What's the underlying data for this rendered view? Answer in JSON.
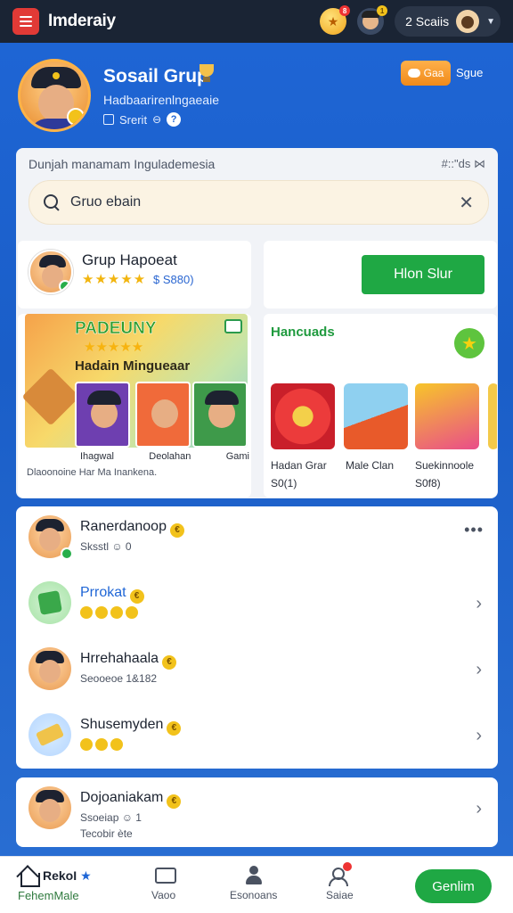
{
  "topbar": {
    "title": "Imderaiy",
    "coin_badge": "8",
    "avatar_badge": "1",
    "user_pill_text": "2 Scaiis"
  },
  "profile": {
    "name": "Sosail Grup",
    "subtitle": "Hadbaarirenlngaeaie",
    "meta": "Srerit",
    "orange_button": "Gaa",
    "share": "Sgue"
  },
  "main_card": {
    "heading": "Dunjah manamam Ingulademesia",
    "heading_right": "#::\"ds ⋈",
    "search": {
      "value": "Gruo ebain",
      "placeholder": "Gruo ebain"
    },
    "group": {
      "title": "Grup Hapoeat",
      "stars": "★★★★★",
      "stars_value": "$ S880)"
    },
    "join_button": "Hlon Slur",
    "promo": {
      "title": "PADEUNY",
      "subtitle": "Hadain Mingueaar",
      "labels": [
        "Ihagwal",
        "Deolahan",
        "Gami"
      ],
      "footer": "Dlaoonoine Har Ma Inankena."
    },
    "featured": {
      "title": "Hancuads",
      "items": [
        {
          "name": "Hadan Grar",
          "sub": "S0(1)"
        },
        {
          "name": "Male Clan",
          "sub": ""
        },
        {
          "name": "Suekinnoole",
          "sub": "S0f8)"
        }
      ]
    }
  },
  "members": [
    {
      "name": "Ranerdanoop",
      "sub": "Sksstl ☺ 0",
      "action": "more"
    },
    {
      "name": "Prrokat",
      "sub": "",
      "action": "chevron"
    },
    {
      "name": "Hrrehahaala",
      "sub": "Seooeoe 1&182",
      "action": "chevron"
    },
    {
      "name": "Shusemyden",
      "sub": "",
      "action": "chevron"
    }
  ],
  "last_member": {
    "name": "Dojoaniakam",
    "sub": "Ssoeiap ☺ 1",
    "sub2": "Tecobir ète"
  },
  "bottom_nav": {
    "home_top": "RekoI",
    "home_bottom": "FehemMale",
    "items": [
      "Vaoo",
      "Esonoans",
      "Saiae"
    ],
    "cta": "Genlim"
  },
  "colors": {
    "brand_blue": "#1f66d6",
    "topbar": "#1a2434",
    "green": "#1fa844",
    "accent_red": "#e13a36",
    "gold": "#f2c21b"
  }
}
